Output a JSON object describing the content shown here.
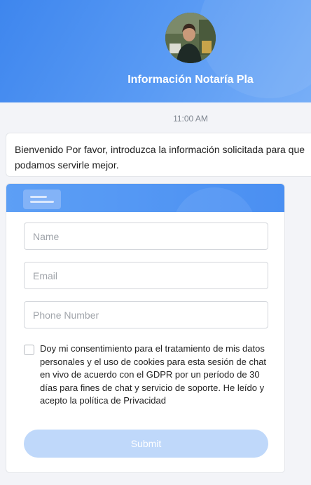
{
  "header": {
    "agent_name": "Información Notaría Pla",
    "avatar": "agent-photo",
    "gradient_start": "#3e86ee",
    "gradient_end": "#77aef7"
  },
  "chat": {
    "timestamp": "11:00 AM",
    "welcome_message": "Bienvenido Por favor, introduzca la información solicitada para que podamos servirle mejor."
  },
  "form": {
    "icon": "form-icon",
    "name_placeholder": "Name",
    "email_placeholder": "Email",
    "phone_placeholder": "Phone Number",
    "consent_checked": false,
    "consent_text": "Doy mi consentimiento para el tratamiento de mis datos personales y el uso de cookies para esta sesión de chat en vivo de acuerdo con el GDPR por un período de 30 días para fines de chat y servicio de soporte. He leído y acepto la política de Privacidad",
    "submit_label": "Submit",
    "submit_color": "#bfd8fa"
  }
}
